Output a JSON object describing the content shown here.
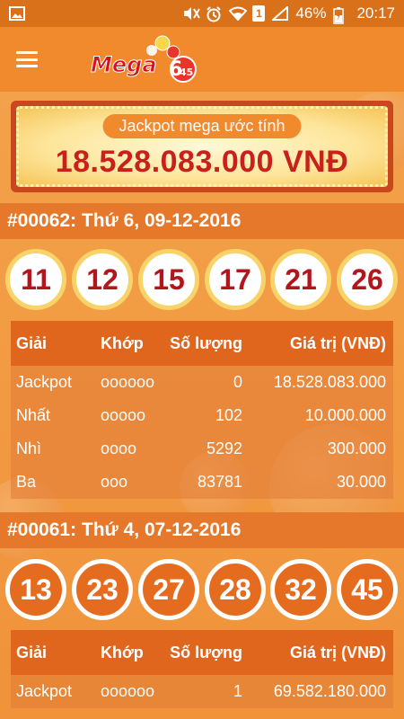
{
  "status_bar": {
    "battery": "46%",
    "time": "20:17",
    "sim": "1"
  },
  "app": {
    "logo_text": "Mega",
    "logo_number_top": "6",
    "logo_number_bottom": "45"
  },
  "jackpot": {
    "label": "Jackpot mega ước tính",
    "amount": "18.528.083.000 VNĐ"
  },
  "table_headers": {
    "prize": "Giải",
    "match": "Khớp",
    "count": "Số lượng",
    "value": "Giá trị (VNĐ)"
  },
  "draws": [
    {
      "title": "#00062: Thứ 6, 09-12-2016",
      "numbers": [
        "11",
        "12",
        "15",
        "17",
        "21",
        "26"
      ],
      "prizes": [
        {
          "prize": "Jackpot",
          "match": "oooooo",
          "count": "0",
          "value": "18.528.083.000"
        },
        {
          "prize": "Nhất",
          "match": "ooooo",
          "count": "102",
          "value": "10.000.000"
        },
        {
          "prize": "Nhì",
          "match": "oooo",
          "count": "5292",
          "value": "300.000"
        },
        {
          "prize": "Ba",
          "match": "ooo",
          "count": "83781",
          "value": "30.000"
        }
      ]
    },
    {
      "title": "#00061: Thứ 4, 07-12-2016",
      "numbers": [
        "13",
        "23",
        "27",
        "28",
        "32",
        "45"
      ],
      "prizes": [
        {
          "prize": "Jackpot",
          "match": "oooooo",
          "count": "1",
          "value": "69.582.180.000"
        }
      ]
    }
  ],
  "colors": {
    "primary_orange": "#f08a2c",
    "status_bar": "#d9701a",
    "jackpot_red": "#c8201a",
    "ball_number_red": "#b3151d"
  },
  "icons": [
    "gallery-icon",
    "mute-icon",
    "alarm-icon",
    "wifi-icon",
    "signal-icon",
    "battery-charging-icon",
    "menu-icon"
  ]
}
